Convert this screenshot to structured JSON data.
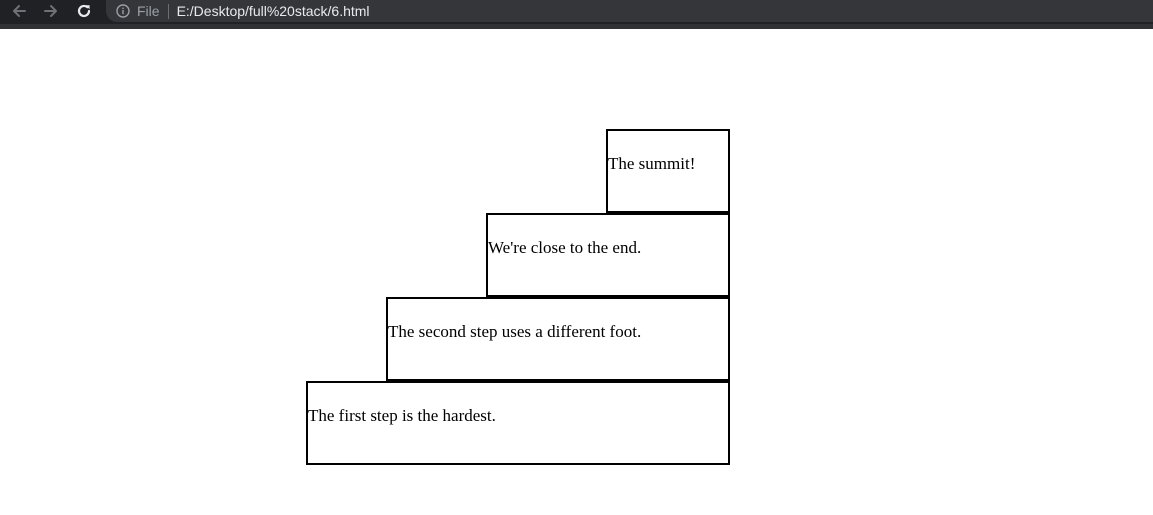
{
  "browser": {
    "icons": {
      "back": "arrow-left-icon",
      "forward": "arrow-right-icon",
      "reload": "reload-icon",
      "info": "info-circle-icon"
    },
    "scheme_label": "File",
    "url": "E:/Desktop/full%20stack/6.html",
    "colors": {
      "toolbar": "#202124",
      "omnibox": "#35363a",
      "url_text": "#e8eaed",
      "muted": "#9aa0a6"
    }
  },
  "staircase": {
    "steps": [
      {
        "text": "The summit!"
      },
      {
        "text": "We're close to the end."
      },
      {
        "text": "The second step uses a different foot."
      },
      {
        "text": "The first step is the hardest."
      }
    ]
  }
}
